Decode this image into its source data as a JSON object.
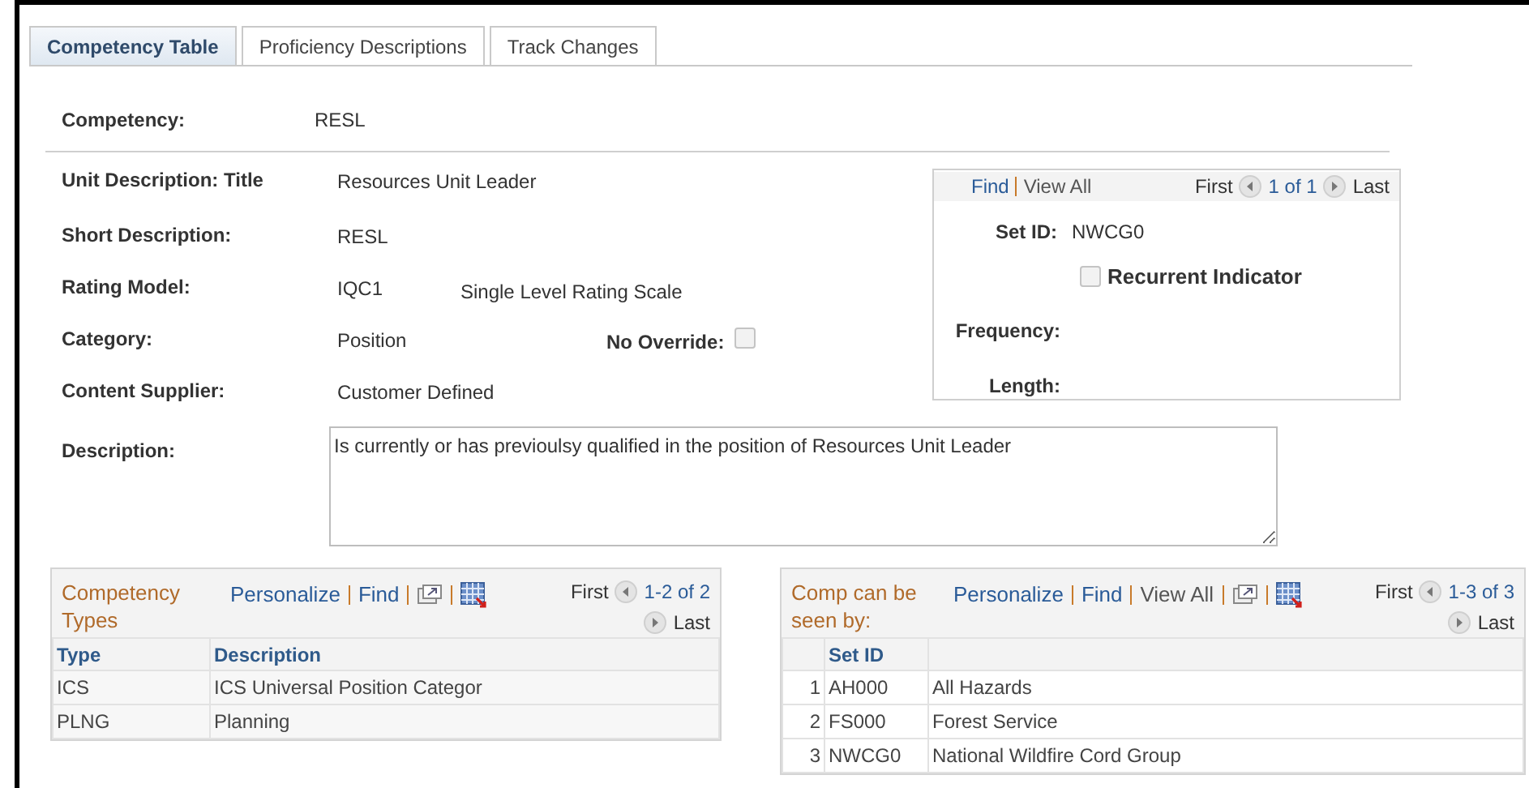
{
  "tabs": [
    {
      "label": "Competency Table",
      "selected": true
    },
    {
      "label": "Proficiency Descriptions",
      "selected": false
    },
    {
      "label": "Track Changes",
      "selected": false
    }
  ],
  "competency": {
    "label": "Competency:",
    "value": "RESL"
  },
  "fields": [
    {
      "label": "Unit Description: Title",
      "value": "Resources Unit Leader"
    },
    {
      "label": "Short Description:",
      "value": "RESL"
    },
    {
      "label": "Rating Model:",
      "value": "IQC1",
      "value_2": "Single Level Rating Scale"
    },
    {
      "label": "Category:",
      "value": "Position",
      "check_label": "No Override:",
      "checked": false
    },
    {
      "label": "Content Supplier:",
      "value": "Customer Defined"
    }
  ],
  "description": {
    "label": "Description:",
    "value": "Is currently or has previoulsy qualified in the position of Resources Unit Leader"
  },
  "set_box": {
    "links": [
      "Find",
      "View All"
    ],
    "first": "First",
    "count": "1 of 1",
    "last": "Last",
    "set_id_label": "Set ID:",
    "set_id": "NWCG0",
    "recurrent_label": "Recurrent Indicator",
    "recurrent_checked": false,
    "frequency_label": "Frequency:",
    "length_label": "Length:"
  },
  "grids": [
    {
      "title": "Competency Types",
      "links": [
        "Personalize",
        "Find"
      ],
      "first": "First",
      "count": "1-2 of 2",
      "last": "Last",
      "columns": [
        "Type",
        "Description"
      ],
      "rows": [
        [
          "ICS",
          "ICS Universal Position Categor"
        ],
        [
          "PLNG",
          "Planning"
        ]
      ]
    },
    {
      "title": "Comp can be seen by:",
      "links": [
        "Personalize",
        "Find",
        "View All"
      ],
      "first": "First",
      "count": "1-3 of 3",
      "last": "Last",
      "columns": [
        "",
        "Set ID",
        ""
      ],
      "rows": [
        [
          "1",
          "AH000",
          "All Hazards"
        ],
        [
          "2",
          "FS000",
          "Forest Service"
        ],
        [
          "3",
          "NWCG0",
          "National Wildfire Cord Group"
        ]
      ]
    }
  ]
}
